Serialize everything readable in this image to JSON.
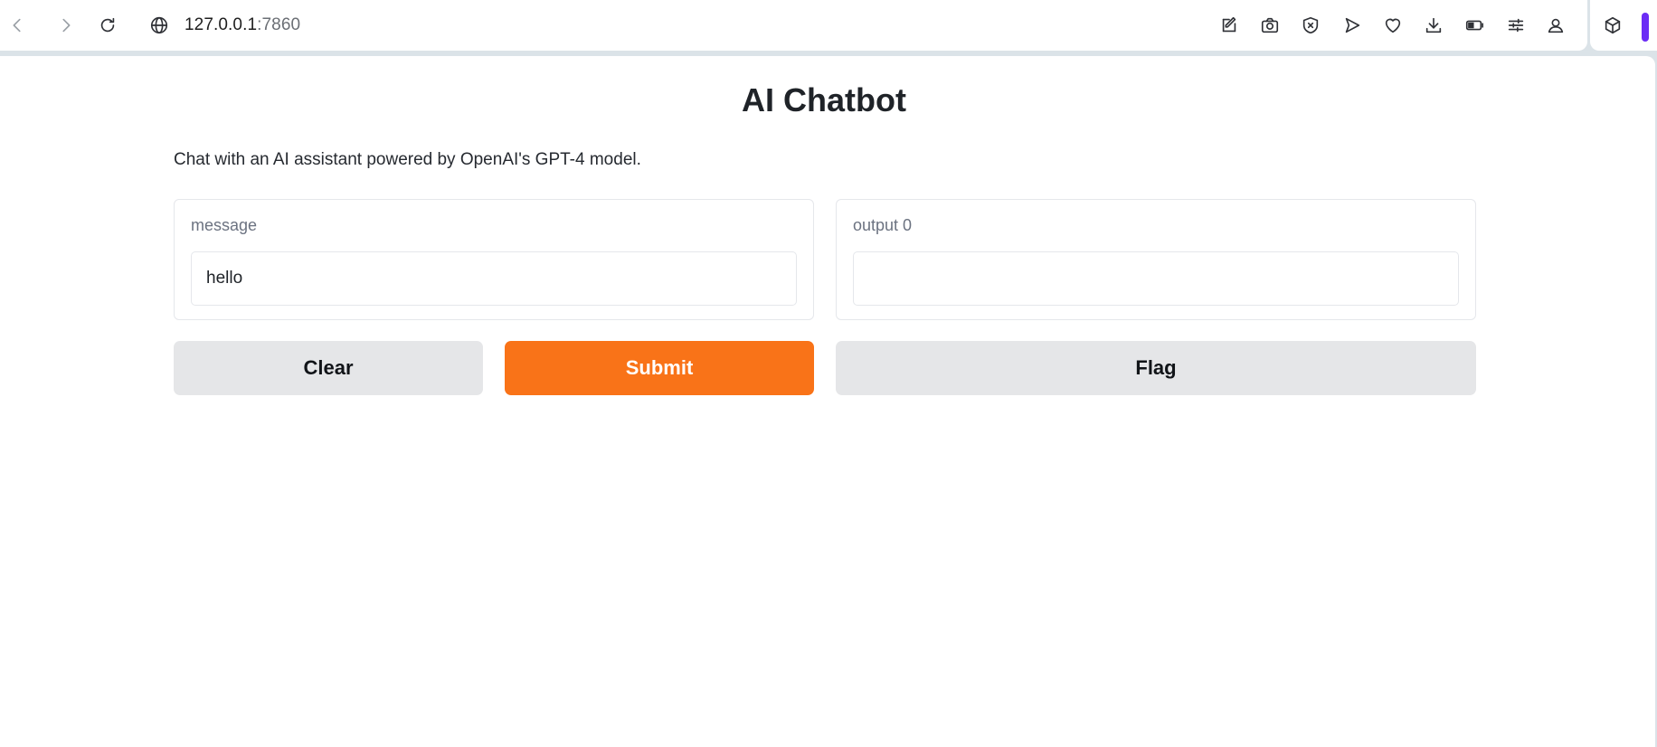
{
  "browser": {
    "url_host": "127.0.0.1",
    "url_port": ":7860",
    "toolbar_icons": [
      "back-icon",
      "forward-icon",
      "reload-icon",
      "site-info-globe-icon",
      "edit-icon",
      "camera-icon",
      "shield-x-icon",
      "send-icon",
      "heart-icon",
      "download-icon",
      "battery-toggle-icon",
      "sliders-icon",
      "profile-icon",
      "extension-cube-icon"
    ],
    "accent_color": "#6b2cf5"
  },
  "app": {
    "title": "AI Chatbot",
    "description": "Chat with an AI assistant powered by OpenAI's GPT-4 model."
  },
  "input_panel": {
    "label": "message",
    "value": "hello"
  },
  "output_panel": {
    "label": "output 0",
    "value": ""
  },
  "actions": {
    "clear_label": "Clear",
    "submit_label": "Submit",
    "flag_label": "Flag",
    "primary_color": "#f97318"
  }
}
